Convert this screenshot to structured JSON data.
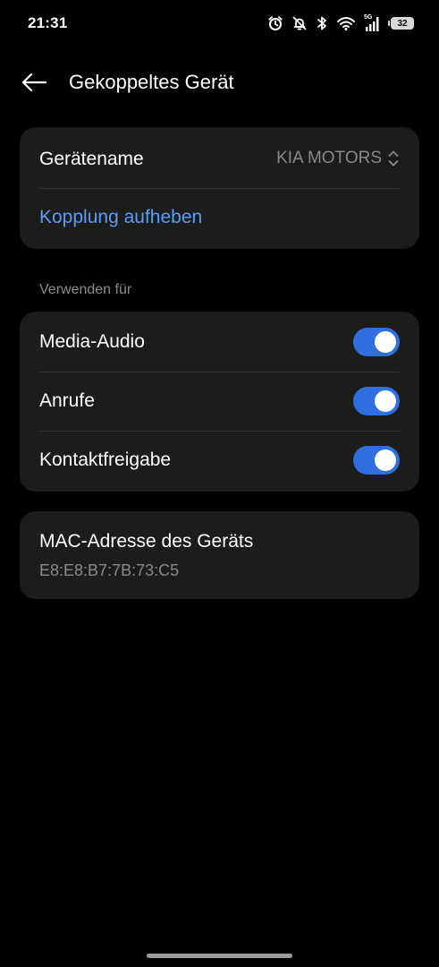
{
  "status_bar": {
    "time": "21:31",
    "network_label": "5G",
    "battery_level": "32",
    "icons": [
      "alarm-icon",
      "mute-bell-icon",
      "bluetooth-icon",
      "wifi-icon",
      "signal-5g-icon",
      "battery-icon"
    ]
  },
  "header": {
    "title": "Gekoppeltes Gerät",
    "back_icon": "back-arrow-icon"
  },
  "device_card": {
    "name_label": "Gerätename",
    "name_value": "KIA MOTORS",
    "unpair_label": "Kopplung aufheben"
  },
  "use_for": {
    "section_label": "Verwenden für",
    "items": [
      {
        "label": "Media-Audio",
        "enabled": true
      },
      {
        "label": "Anrufe",
        "enabled": true
      },
      {
        "label": "Kontaktfreigabe",
        "enabled": true
      }
    ]
  },
  "mac_card": {
    "title": "MAC-Adresse des Geräts",
    "value": "E8:E8:B7:7B:73:C5"
  },
  "colors": {
    "background": "#000000",
    "card": "#1c1c1c",
    "accent_link": "#5b9cf5",
    "toggle_on": "#2f6fe0",
    "secondary_text": "#8a8a8a"
  }
}
